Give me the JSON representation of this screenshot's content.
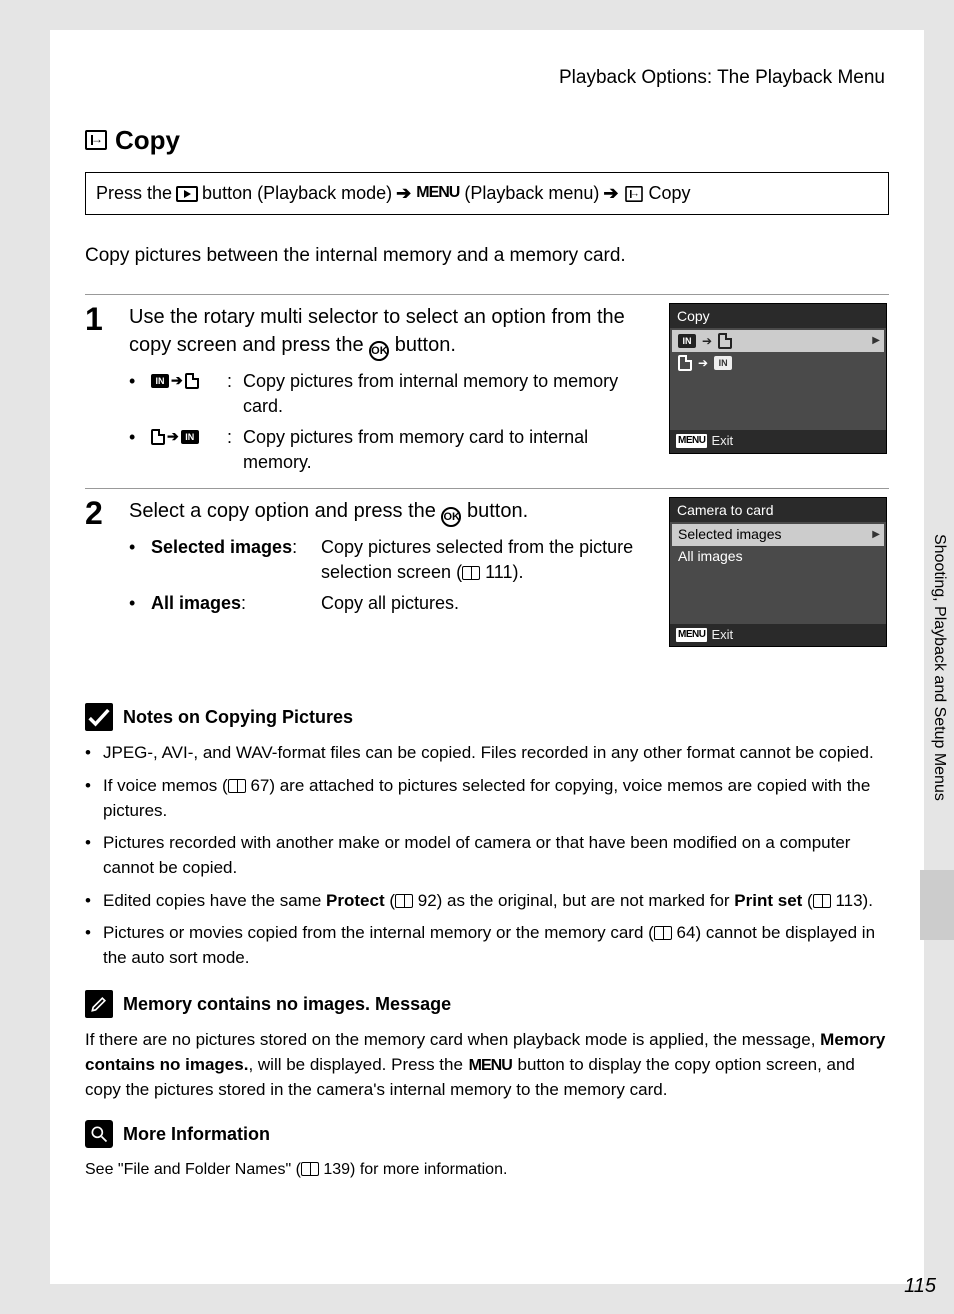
{
  "header": "Playback Options: The Playback Menu",
  "title": "Copy",
  "navbox": {
    "press_the": "Press the",
    "button_playback_mode": "button (Playback mode)",
    "menu_label": "MENU",
    "playback_menu": "(Playback menu)",
    "copy": "Copy"
  },
  "intro": "Copy pictures between the internal memory and a memory card.",
  "step1": {
    "num": "1",
    "text_a": "Use the rotary multi selector to select an",
    "text_b": "option from the copy screen and press the",
    "text_c": "button.",
    "li1": "Copy pictures from internal memory to memory card.",
    "li2": "Copy pictures from memory card to internal memory."
  },
  "cam1": {
    "title": "Copy",
    "exit": "Exit"
  },
  "step2": {
    "num": "2",
    "text_a": "Select a copy option and press the",
    "text_b": "button.",
    "li1_label": "Selected images",
    "li1_text_a": "Copy pictures selected from the picture selection screen (",
    "li1_text_b": "111).",
    "li2_label": "All images",
    "li2_text": "Copy all pictures."
  },
  "cam2": {
    "title": "Camera to card",
    "row1": "Selected images",
    "row2": "All images",
    "exit": "Exit"
  },
  "notes": {
    "heading": "Notes on Copying Pictures",
    "n1": "JPEG-, AVI-, and WAV-format files can be copied. Files recorded in any other format cannot be copied.",
    "n2_a": "If voice memos (",
    "n2_b": "67) are attached to pictures selected for copying, voice memos are copied with the pictures.",
    "n3": "Pictures recorded with another make or model of camera or that have been modified on a computer cannot be copied.",
    "n4_a": "Edited copies have the same ",
    "n4_b": "Protect",
    "n4_c": " (",
    "n4_d": "92) as the original, but are not marked for ",
    "n4_e": "Print set",
    "n4_f": " (",
    "n4_g": "113).",
    "n5_a": "Pictures or movies copied from the internal memory or the memory card (",
    "n5_b": "64) cannot be displayed in the auto sort mode."
  },
  "memory_msg": {
    "heading": "Memory contains no images. Message",
    "p_a": "If there are no pictures stored on the memory card when playback mode is applied, the message, ",
    "p_b": "Memory contains no images.",
    "p_c": ", will be displayed. Press the ",
    "p_d": "MENU",
    "p_e": " button to display the copy option screen, and copy the pictures stored in the camera's internal memory to the memory card."
  },
  "more_info": {
    "heading": "More Information",
    "p_a": "See \"File and Folder Names\" (",
    "p_b": "139) for more information."
  },
  "side_tab": "Shooting, Playback and Setup Menus",
  "page_number": "115"
}
